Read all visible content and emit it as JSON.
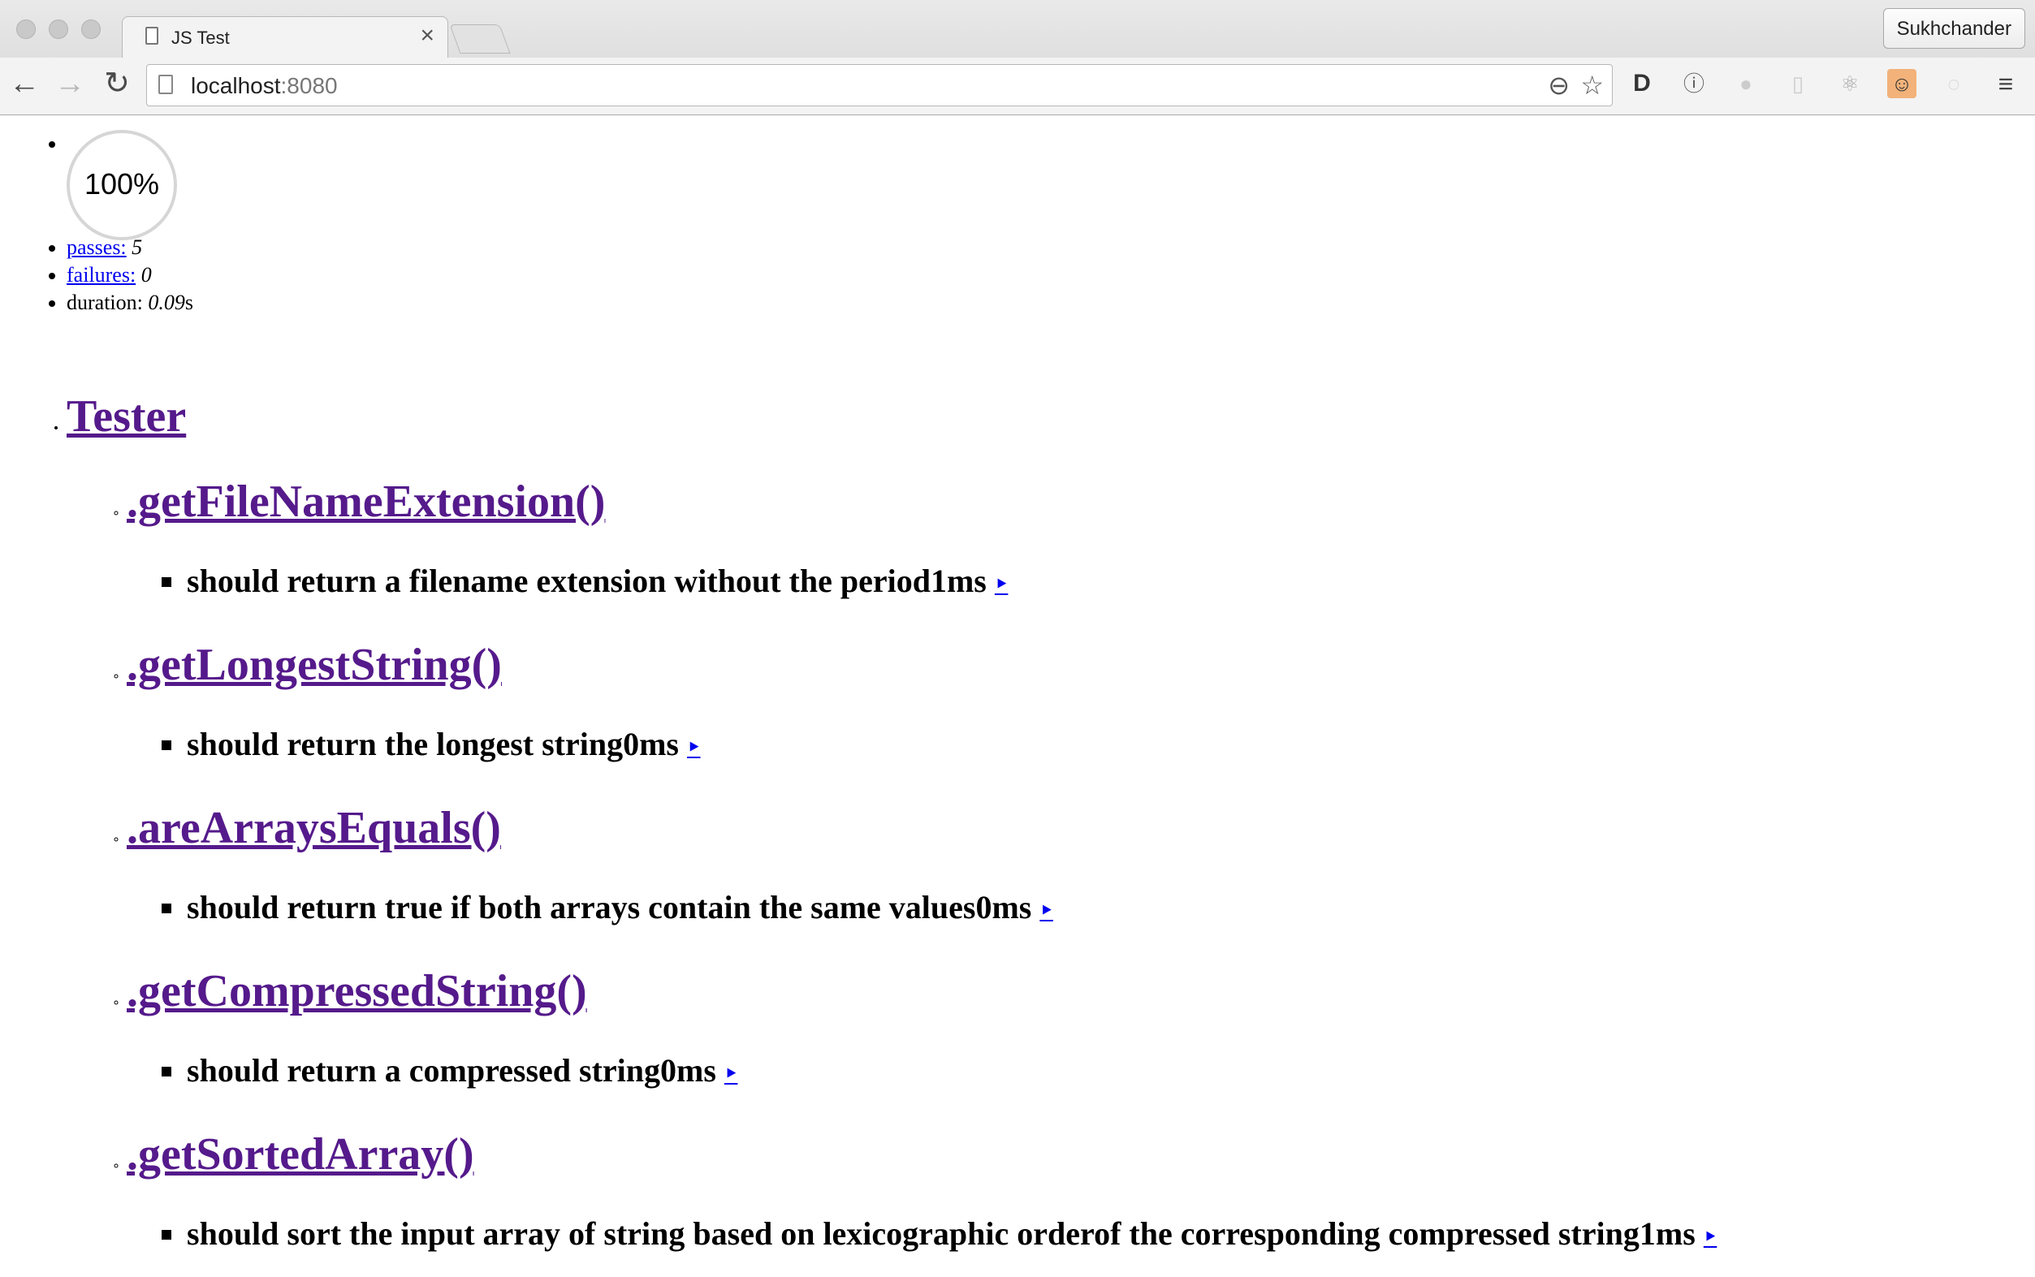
{
  "browser": {
    "tab_title": "JS Test",
    "tab_close": "×",
    "profile_name": "Sukhchander",
    "url_host": "localhost",
    "url_port": ":8080"
  },
  "stats": {
    "progress": "100%",
    "passes_label": "passes:",
    "passes_value": "5",
    "failures_label": "failures:",
    "failures_value": "0",
    "duration_label": "duration:",
    "duration_value": "0.09",
    "duration_unit": "s"
  },
  "report": {
    "root_suite": "Tester",
    "suites": [
      {
        "title": ".getFileNameExtension()",
        "test": "should return a filename extension without the period",
        "duration": "1ms"
      },
      {
        "title": ".getLongestString()",
        "test": "should return the longest string",
        "duration": "0ms"
      },
      {
        "title": ".areArraysEquals()",
        "test": "should return true if both arrays contain the same values",
        "duration": "0ms"
      },
      {
        "title": ".getCompressedString()",
        "test": "should return a compressed string",
        "duration": "0ms"
      },
      {
        "title": ".getSortedArray()",
        "test": "should sort the input array of string based on lexicographic orderof the corresponding compressed string",
        "duration": "1ms"
      }
    ],
    "replay_glyph": "‣"
  }
}
